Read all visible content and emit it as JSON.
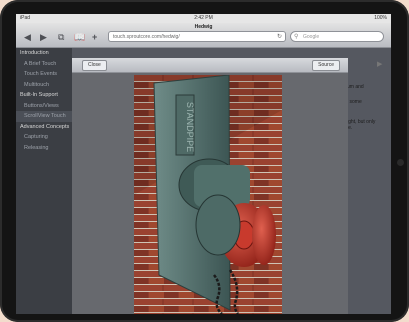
{
  "status": {
    "carrier": "iPad",
    "time": "2:42 PM",
    "battery": "100%"
  },
  "browser": {
    "title": "Hedwig",
    "url": "touch.sproutcore.com/hedwig/",
    "search_placeholder": "Google"
  },
  "sidebar": {
    "items": [
      {
        "label": "Introduction",
        "level": 1
      },
      {
        "label": "A Brief Touch",
        "level": 2
      },
      {
        "label": "Touch Events",
        "level": 2
      },
      {
        "label": "Multitouch",
        "level": 2
      },
      {
        "label": "Built-In Support",
        "level": 1
      },
      {
        "label": "Buttons/Views",
        "level": 2
      },
      {
        "label": "ScrollView Touch",
        "level": 2,
        "selected": true
      },
      {
        "label": "Advanced Concepts",
        "level": 1
      },
      {
        "label": "Capturing",
        "level": 2
      },
      {
        "label": "Releasing",
        "level": 2
      }
    ]
  },
  "content_fragments": [
    "um and",
    "l some",
    "ight, but only",
    "le."
  ],
  "modal": {
    "close_label": "Close",
    "source_label": "Source"
  },
  "photo": {
    "wall_sign": "STANDPIPE"
  },
  "icons": [
    "back-icon",
    "forward-icon",
    "pages-icon",
    "bookmarks-icon",
    "add-icon",
    "reload-icon",
    "search-icon",
    "next-arrow-icon"
  ]
}
